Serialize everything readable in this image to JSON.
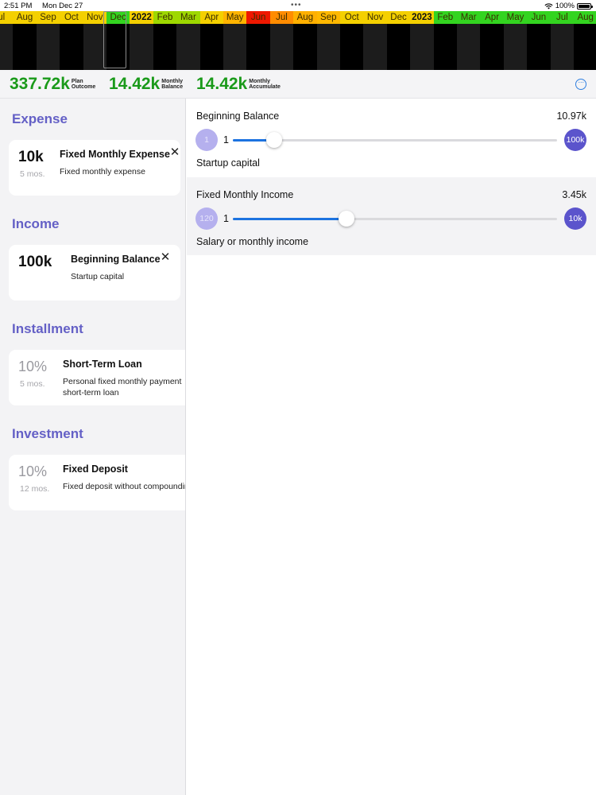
{
  "status_bar": {
    "time": "2:51 PM",
    "date": "Mon Dec 27",
    "battery": "100%"
  },
  "timeline": {
    "months": [
      {
        "label": "ul",
        "color": "#f4d000",
        "year": false
      },
      {
        "label": "Aug",
        "color": "#f4d000",
        "year": false
      },
      {
        "label": "Sep",
        "color": "#f4d000",
        "year": false
      },
      {
        "label": "Oct",
        "color": "#f4d000",
        "year": false
      },
      {
        "label": "Nov",
        "color": "#f4d000",
        "year": false
      },
      {
        "label": "Dec",
        "color": "#33d420",
        "year": false
      },
      {
        "label": "2022",
        "color": "#f4d000",
        "year": true
      },
      {
        "label": "Feb",
        "color": "#9ed800",
        "year": false
      },
      {
        "label": "Mar",
        "color": "#9ed800",
        "year": false
      },
      {
        "label": "Apr",
        "color": "#f4d000",
        "year": false
      },
      {
        "label": "May",
        "color": "#ffb400",
        "year": false
      },
      {
        "label": "Jun",
        "color": "#ee1800",
        "year": false
      },
      {
        "label": "Jul",
        "color": "#ff8c00",
        "year": false
      },
      {
        "label": "Aug",
        "color": "#ffb000",
        "year": false
      },
      {
        "label": "Sep",
        "color": "#ffb800",
        "year": false
      },
      {
        "label": "Oct",
        "color": "#f4d000",
        "year": false
      },
      {
        "label": "Nov",
        "color": "#f4d000",
        "year": false
      },
      {
        "label": "Dec",
        "color": "#f4d000",
        "year": false
      },
      {
        "label": "2023",
        "color": "#f4d000",
        "year": true
      },
      {
        "label": "Feb",
        "color": "#33d420",
        "year": false
      },
      {
        "label": "Mar",
        "color": "#33d420",
        "year": false
      },
      {
        "label": "Apr",
        "color": "#33d420",
        "year": false
      },
      {
        "label": "May",
        "color": "#33d420",
        "year": false
      },
      {
        "label": "Jun",
        "color": "#33d420",
        "year": false
      },
      {
        "label": "Jul",
        "color": "#33d420",
        "year": false
      },
      {
        "label": "Aug",
        "color": "#33d420",
        "year": false
      }
    ]
  },
  "summary": {
    "plan_outcome": {
      "value": "337.72k",
      "label_1": "Plan",
      "label_2": "Outcome"
    },
    "monthly_balance": {
      "value": "14.42k",
      "label_1": "Monthly",
      "label_2": "Balance"
    },
    "monthly_accumulate": {
      "value": "14.42k",
      "label_1": "Monthly",
      "label_2": "Accumulate"
    },
    "more_icon": "ellipsis-circle-icon",
    "value_color": "#1a9a1a"
  },
  "sidebar": {
    "sections": [
      {
        "title": "Expense",
        "card": {
          "value": "10k",
          "sub": "5 mos.",
          "title": "Fixed Monthly Expense",
          "desc": "Fixed monthly expense",
          "closable": true
        }
      },
      {
        "title": "Income",
        "card": {
          "value": "100k",
          "sub": "",
          "title": "Beginning Balance",
          "desc": "Startup capital",
          "closable": true
        }
      },
      {
        "title": "Installment",
        "card": {
          "value": "10%",
          "sub": "5 mos.",
          "title": "Short-Term Loan",
          "desc": "Personal fixed monthly payment short-term loan",
          "closable": false
        }
      },
      {
        "title": "Investment",
        "card": {
          "value": "10%",
          "sub": "12 mos.",
          "title": "Fixed Deposit",
          "desc": "Fixed deposit without compounding",
          "closable": false
        }
      }
    ],
    "section_title_color": "#6460c6"
  },
  "detail": {
    "rows": [
      {
        "title": "Beginning Balance",
        "value": "10.97k",
        "step_min": "1",
        "slider_min": "1",
        "step_max": "100k",
        "slider_fraction": 0.128,
        "desc": "Startup capital"
      },
      {
        "title": "Fixed Monthly Income",
        "value": "3.45k",
        "step_min": "120",
        "slider_min": "1",
        "step_max": "10k",
        "slider_fraction": 0.35,
        "desc": "Salary or monthly income"
      }
    ],
    "accent_color": "#1c73e0",
    "step_color": "#5b54cc"
  }
}
